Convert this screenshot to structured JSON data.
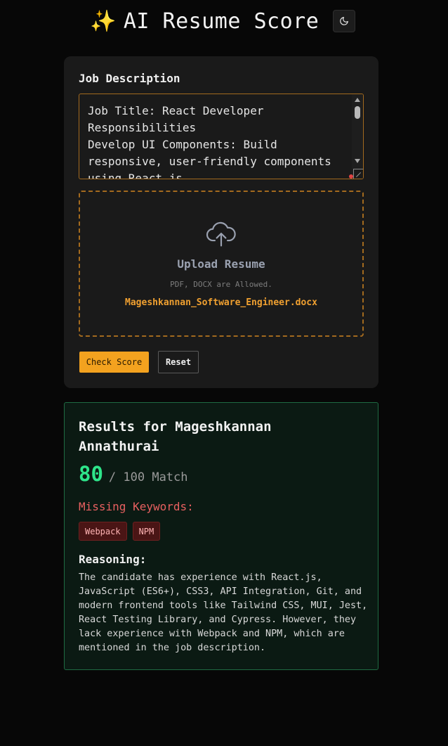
{
  "header": {
    "spark_glyph": "✨",
    "title": "AI Resume Score",
    "theme_icon": "moon-icon"
  },
  "form": {
    "jd_label": "Job Description",
    "jd_value": "Job Title: React Developer\nResponsibilities\nDevelop UI Components: Build\nresponsive, user-friendly components\nusing React.js",
    "upload": {
      "icon": "cloud-upload-icon",
      "title": "Upload Resume",
      "hint": "PDF, DOCX are Allowed.",
      "file_name": "Mageshkannan_Software_Engineer.docx"
    },
    "check_label": "Check Score",
    "reset_label": "Reset"
  },
  "results": {
    "title": "Results for Mageshkannan Annathurai",
    "score": "80",
    "score_suffix": "/ 100 Match",
    "missing_label": "Missing Keywords:",
    "missing_keywords": [
      "Webpack",
      "NPM"
    ],
    "reasoning_label": "Reasoning:",
    "reasoning": "The candidate has experience with React.js, JavaScript (ES6+), CSS3, API Integration, Git, and modern frontend tools like Tailwind CSS, MUI, Jest, React Testing Library, and Cypress. However, they lack experience with Webpack and NPM, which are mentioned in the job description."
  },
  "colors": {
    "accent": "#f3a21f",
    "score": "#2ee58a",
    "missing": "#e86060",
    "results_border": "#1f6b43"
  }
}
